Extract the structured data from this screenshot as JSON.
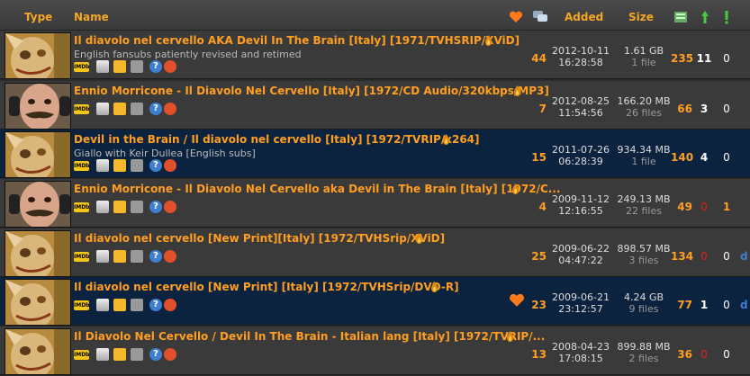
{
  "header": {
    "type": "Type",
    "name": "Name",
    "added": "Added",
    "size": "Size"
  },
  "rows": [
    {
      "title": "Il diavolo nel cervello AKA Devil In The Brain [Italy] [1971/TVHSRIP/XViD]",
      "subtitle": "English fansubs patiently revised and retimed",
      "comments": "44",
      "date": "2012-10-11",
      "time": "16:28:58",
      "size": "1.61 GB",
      "files": "1 file",
      "seeders": "235",
      "leechers": "11",
      "completed": "0",
      "extra": "",
      "thumb": "zombie",
      "shade": "odd",
      "heart": false
    },
    {
      "title": "Ennio Morricone - Il Diavolo Nel Cervello [Italy] [1972/CD Audio/320kbps/MP3]",
      "subtitle": "",
      "comments": "7",
      "date": "2012-08-25",
      "time": "11:54:56",
      "size": "166.20 MB",
      "files": "26 files",
      "seeders": "66",
      "leechers": "3",
      "completed": "0",
      "extra": "",
      "thumb": "man",
      "shade": "odd",
      "heart": false
    },
    {
      "title": "Devil in the Brain / Il diavolo nel cervello [Italy] [1972/TVRIP/x264]",
      "subtitle": "Giallo with Keir Dullea [English subs]",
      "comments": "15",
      "date": "2011-07-26",
      "time": "06:28:39",
      "size": "934.34 MB",
      "files": "1 file",
      "seeders": "140",
      "leechers": "4",
      "completed": "0",
      "extra": "",
      "thumb": "zombie",
      "shade": "even",
      "heart": false
    },
    {
      "title": "Ennio Morricone - Il Diavolo Nel Cervello aka Devil in The Brain [Italy] [1972/C...",
      "subtitle": "",
      "comments": "4",
      "date": "2009-11-12",
      "time": "12:16:55",
      "size": "249.13 MB",
      "files": "22 files",
      "seeders": "49",
      "leechers": "0",
      "completed": "1",
      "extra": "",
      "thumb": "man",
      "shade": "odd",
      "heart": false
    },
    {
      "title": "Il diavolo nel cervello [New Print][Italy] [1972/TVHSrip/XViD]",
      "subtitle": "",
      "comments": "25",
      "date": "2009-06-22",
      "time": "04:47:22",
      "size": "898.57 MB",
      "files": "3 files",
      "seeders": "134",
      "leechers": "0",
      "completed": "0",
      "extra": "d",
      "thumb": "zombie",
      "shade": "odd",
      "heart": false
    },
    {
      "title": "Il diavolo nel cervello [New Print] [Italy] [1972/TVHSrip/DVD-R]",
      "subtitle": "",
      "comments": "23",
      "date": "2009-06-21",
      "time": "23:12:57",
      "size": "4.24 GB",
      "files": "9 files",
      "seeders": "77",
      "leechers": "1",
      "completed": "0",
      "extra": "d",
      "thumb": "zombie",
      "shade": "even",
      "heart": true
    },
    {
      "title": "Il Diavolo Nel Cervello / Devil In The Brain - Italian lang [Italy] [1972/TVRIP/...",
      "subtitle": "",
      "comments": "13",
      "date": "2008-04-23",
      "time": "17:08:15",
      "size": "899.88 MB",
      "files": "2 files",
      "seeders": "36",
      "leechers": "0",
      "completed": "0",
      "extra": "",
      "thumb": "zombie",
      "shade": "odd",
      "heart": false
    }
  ],
  "icon_labels": {
    "imdb": "IMDb",
    "help": "?"
  },
  "colors": {
    "accent": "#ff9e21",
    "row_odd": "#3a3a3a",
    "row_even": "#0c2340",
    "zero": "#e02020"
  }
}
